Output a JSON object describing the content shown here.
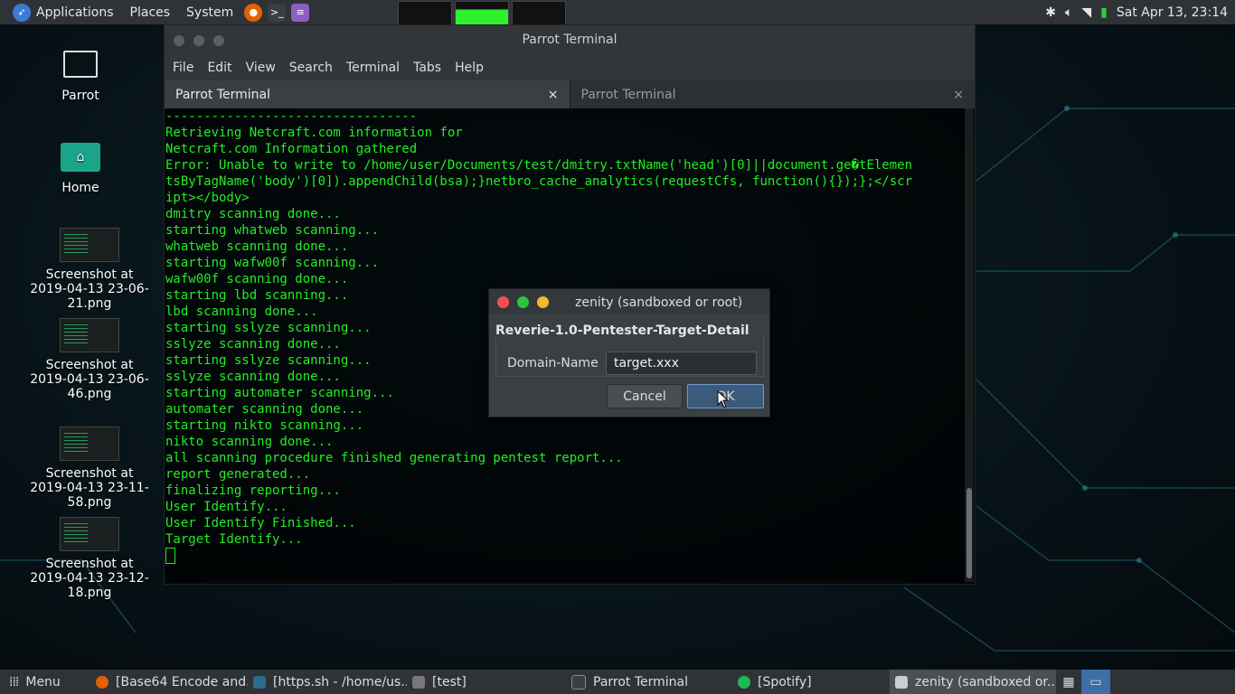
{
  "top_panel": {
    "applications": "Applications",
    "places": "Places",
    "system": "System",
    "clock": "Sat Apr 13, 23:14"
  },
  "desktop": {
    "icons": [
      {
        "label": "Parrot"
      },
      {
        "label": "Home"
      },
      {
        "label": "Screenshot at 2019-04-13 23-06-21.png"
      },
      {
        "label": "Screenshot at 2019-04-13 23-06-46.png"
      },
      {
        "label": "Screenshot at 2019-04-13 23-11-58.png"
      },
      {
        "label": "Screenshot at 2019-04-13 23-12-18.png"
      }
    ]
  },
  "terminal": {
    "title": "Parrot Terminal",
    "menu": [
      "File",
      "Edit",
      "View",
      "Search",
      "Terminal",
      "Tabs",
      "Help"
    ],
    "tabs": [
      {
        "label": "Parrot Terminal",
        "close": "×"
      },
      {
        "label": "Parrot Terminal",
        "close": "×"
      }
    ],
    "lines": [
      "---------------------------------",
      "",
      "Retrieving Netcraft.com information for",
      "Netcraft.com Information gathered",
      "Error: Unable to write to /home/user/Documents/test/dmitry.txtName('head')[0]||document.ge�tElemen",
      "tsByTagName('body')[0]).appendChild(bsa);}netbro_cache_analytics(requestCfs, function(){});};</scr",
      "ipt></body>",
      "dmitry scanning done...",
      "starting whatweb scanning...",
      "whatweb scanning done...",
      "starting wafw00f scanning...",
      "wafw00f scanning done...",
      "starting lbd scanning...",
      "lbd scanning done...",
      "starting sslyze scanning...",
      "sslyze scanning done...",
      "starting sslyze scanning...",
      "sslyze scanning done...",
      "starting automater scanning...",
      "automater scanning done...",
      "starting nikto scanning...",
      "nikto scanning done...",
      "all scanning procedure finished generating pentest report...",
      "report generated...",
      "finalizing reporting...",
      "User Identify...",
      "User Identify Finished...",
      "Target Identify..."
    ]
  },
  "dialog": {
    "title": "zenity (sandboxed or root)",
    "heading": "Reverie-1.0-Pentester-Target-Detail",
    "field_label": "Domain-Name",
    "field_value": "target.xxx",
    "cancel": "Cancel",
    "ok": "OK"
  },
  "taskbar": {
    "menu": "Menu",
    "tasks": [
      {
        "label": "[Base64 Encode and..."
      },
      {
        "label": "[https.sh - /home/us..."
      },
      {
        "label": "[test]"
      },
      {
        "label": "Parrot Terminal"
      },
      {
        "label": "[Spotify]"
      },
      {
        "label": "zenity (sandboxed or..."
      }
    ]
  }
}
